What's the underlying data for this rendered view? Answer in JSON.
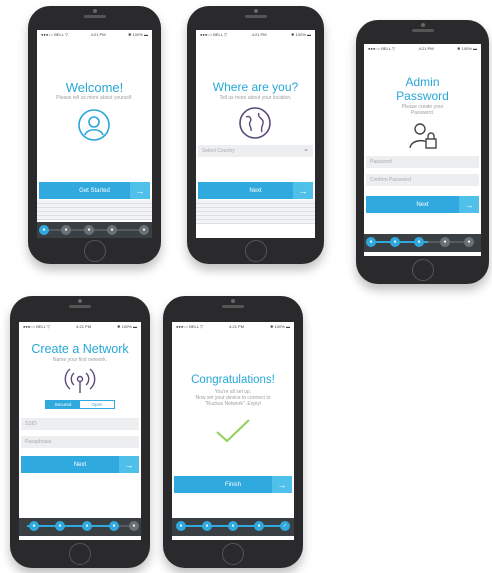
{
  "status_bar": {
    "carrier": "●●●○○ BELL ▽",
    "time": "4:21 PM",
    "battery": "✱ 100% ▬"
  },
  "screens": {
    "welcome": {
      "title": "Welcome!",
      "subtitle": "Please tell us more about yourself.",
      "icon": "user-icon",
      "button_label": "Get Started",
      "arrow": "→"
    },
    "location": {
      "title": "Where are you?",
      "subtitle": "Tell us more about your location.",
      "icon": "globe-icon",
      "select_placeholder": "Select Country",
      "select_chevron": "⌄",
      "button_label": "Next",
      "arrow": "→"
    },
    "admin": {
      "title_line1": "Admin",
      "title_line2": "Password",
      "subtitle_line1": "Please create your",
      "subtitle_line2": "Password.",
      "icon": "admin-lock-icon",
      "password_placeholder": "Password",
      "confirm_placeholder": "Confirm Password",
      "button_label": "Next",
      "arrow": "→"
    },
    "network": {
      "title": "Create a Network",
      "subtitle": "Name your first network.",
      "icon": "wireless-icon",
      "segment_secured": "Secured",
      "segment_open": "Open",
      "ssid_placeholder": "SSID",
      "passphrase_placeholder": "Passphrase",
      "button_label": "Next",
      "arrow": "→"
    },
    "done": {
      "title": "Congratulations!",
      "subtitle_line1": "You're all set up.",
      "subtitle_line2": "Now set your device to connect to",
      "subtitle_line3": "\"Ruckus Network\". Enjoy!",
      "icon": "checkmark-icon",
      "button_label": "Finish",
      "arrow": "→"
    }
  },
  "progress_steps": {
    "welcome": {
      "completed": 1,
      "total": 5
    },
    "location": {
      "completed": 2,
      "total": 5
    },
    "admin": {
      "completed": 3,
      "total": 5
    },
    "network": {
      "completed": 4,
      "total": 5
    },
    "done": {
      "completed": 5,
      "total": 5
    }
  },
  "colors": {
    "accent": "#2fa9de",
    "accent_light": "#4fc0ea",
    "title": "#27a7d8",
    "check": "#8fd15a",
    "progress_bg": "#3a3f44",
    "phone_body": "#2a2a2c"
  }
}
